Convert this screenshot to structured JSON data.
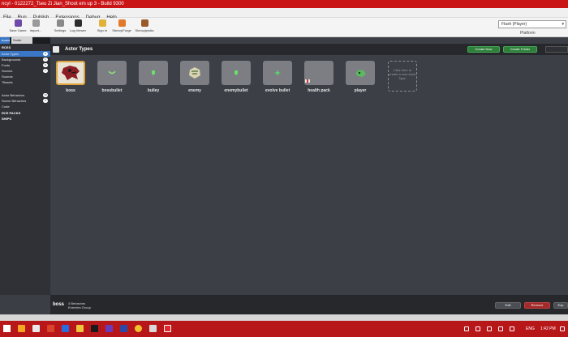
{
  "window": {
    "title": "ncyl - 0122272_Tseu Zi Jian_Shoot em up 3 - Build 9300"
  },
  "menu": [
    "File",
    "Run",
    "Publish",
    "Extensions",
    "Debug",
    "Help"
  ],
  "toolbar": {
    "buttons": [
      "Save Game",
      "Import...",
      "Settings",
      "Log Viewer",
      "Sign In",
      "StencylForge",
      "Stencylpedia"
    ],
    "platform_value": "Flash (Player)",
    "platform_label": "Platform"
  },
  "sidebar": {
    "tabs": [
      "board",
      "Sortie"
    ],
    "resources_header": "RCES",
    "items": [
      {
        "label": "Actor Types",
        "count": "8"
      },
      {
        "label": "Backgrounds",
        "count": "1"
      },
      {
        "label": "Fonts",
        "count": "0"
      },
      {
        "label": "Scenes",
        "count": "1"
      },
      {
        "label": "Sounds",
        "count": ""
      },
      {
        "label": "Tilesets",
        "count": ""
      }
    ],
    "behaviors": [
      {
        "label": "Actor Behaviors",
        "count": "13"
      },
      {
        "label": "Scene Behaviors",
        "count": "4"
      },
      {
        "label": "Code",
        "count": ""
      }
    ],
    "packs_header": "RCE PACKS",
    "ships_header": "SHIPS"
  },
  "main": {
    "title": "Actor Types",
    "create_new": "Create New",
    "create_folder": "Create Folder",
    "actors": [
      {
        "label": "boss"
      },
      {
        "label": "bossbullet"
      },
      {
        "label": "bulley"
      },
      {
        "label": "enemy"
      },
      {
        "label": "enemybullet"
      },
      {
        "label": "evolve bullet"
      },
      {
        "label": "health pack"
      },
      {
        "label": "player"
      }
    ],
    "create_hint": "Click here to create a new Actor Type."
  },
  "footer": {
    "selected_name": "boss",
    "line1": "4 Behaviors",
    "line2": "Enemies Group",
    "edit": "Edit",
    "remove": "Remove",
    "export": "Exp"
  },
  "taskbar": {
    "language": "ENG",
    "time": "1:42 PM"
  },
  "colors": {
    "titlebar": "#ca1517",
    "taskbar": "#b8171a",
    "selection": "#3a78c7",
    "green_button": "#2d7f3a",
    "remove_button": "#a12a2a"
  }
}
